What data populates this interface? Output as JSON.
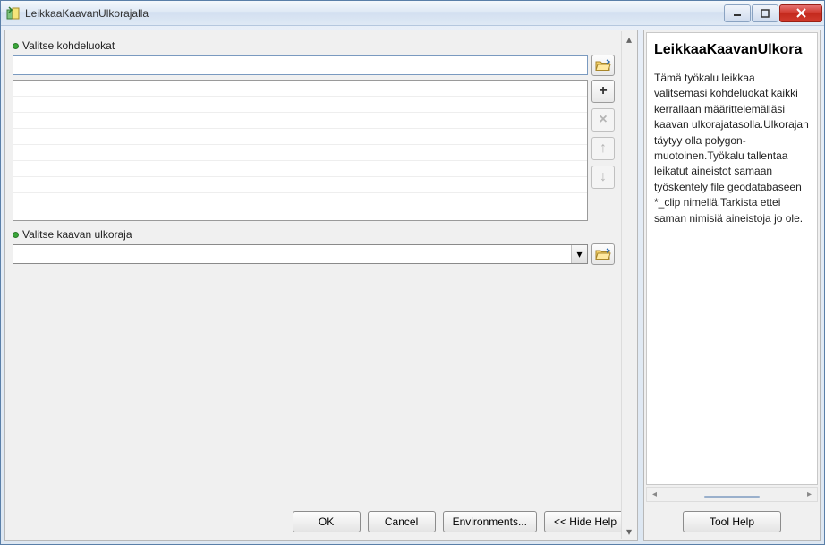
{
  "window": {
    "title": "LeikkaaKaavanUlkorajalla"
  },
  "fields": {
    "kohdeluokat_label": "Valitse kohdeluokat",
    "kavulkoraja_label": "Valitse kaavan ulkoraja",
    "input1_value": "",
    "dropdown_value": ""
  },
  "buttons": {
    "ok": "OK",
    "cancel": "Cancel",
    "environments": "Environments...",
    "hide_help": "<< Hide Help",
    "tool_help": "Tool Help"
  },
  "help": {
    "title": "LeikkaaKaavanUlkora",
    "body": "Tämä työkalu leikkaa valitsemasi kohdeluokat kaikki kerrallaan määrittelemälläsi kaavan ulkorajatasolla.Ulkorajan täytyy olla polygon-muotoinen.Työkalu tallentaa leikatut aineistot samaan työskentely file geodatabaseen *_clip nimellä.Tarkista ettei saman nimisiä aineistoja jo ole."
  },
  "icons": {
    "folder": "folder-open-icon",
    "add": "plus-icon",
    "remove": "x-icon",
    "up": "arrow-up-icon",
    "down": "arrow-down-icon"
  }
}
